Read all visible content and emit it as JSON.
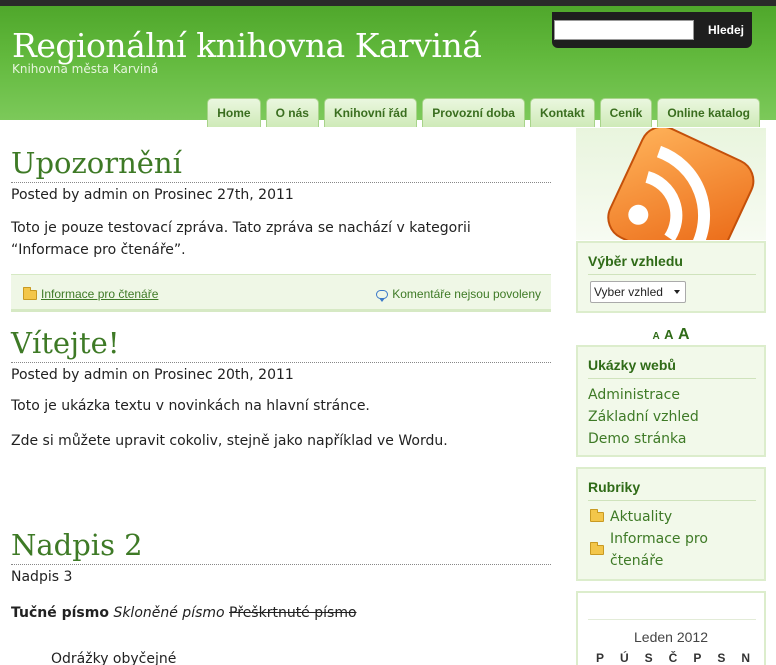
{
  "header": {
    "title": "Regionální knihovna Karviná",
    "subtitle": "Knihovna města Karviná",
    "search_placeholder": "",
    "search_button": "Hledej"
  },
  "nav": [
    "Home",
    "O nás",
    "Knihovní řád",
    "Provozní doba",
    "Kontakt",
    "Ceník",
    "Online katalog"
  ],
  "posts": [
    {
      "title": "Upozornění",
      "meta": "Posted by admin on Prosinec 27th, 2011",
      "body": [
        "Toto je pouze testovací zpráva. Tato zpráva se nachází v kategorii “Informace pro čtenáře”."
      ],
      "category": "Informace pro čtenáře",
      "comments": "Komentáře nejsou povoleny"
    },
    {
      "title": "Vítejte!",
      "meta": "Posted by admin on Prosinec 20th, 2011",
      "body": [
        "Toto je ukázka textu v novinkách na hlavní stránce.",
        "Zde si můžete upravit cokoliv, stejně jako například ve Wordu."
      ]
    }
  ],
  "demo": {
    "h2": "Nadpis 2",
    "h3": "Nadpis 3",
    "bold": "Tučné písmo",
    "italic": "Skloněné písmo",
    "strike": "Přeškrtnuté písmo",
    "list_item": "Odrážky obyčejné"
  },
  "sidebar": {
    "style_widget": {
      "title": "Výběr vzhledu",
      "selected": "Vyber vzhled"
    },
    "font_sizer": [
      "A",
      "A",
      "A"
    ],
    "sites_widget": {
      "title": "Ukázky webů",
      "links": [
        "Administrace",
        "Základní vzhled",
        "Demo stránka"
      ]
    },
    "categories_widget": {
      "title": "Rubriky",
      "items": [
        "Aktuality",
        "Informace pro",
        "čtenáře"
      ]
    },
    "calendar": {
      "month": "Leden 2012",
      "days": [
        "P",
        "Ú",
        "S",
        "Č",
        "P",
        "S",
        "N"
      ]
    }
  },
  "colors": {
    "brand_green": "#5fb13a",
    "link_green": "#3e7a26",
    "rss_orange": "#f07a1a"
  }
}
